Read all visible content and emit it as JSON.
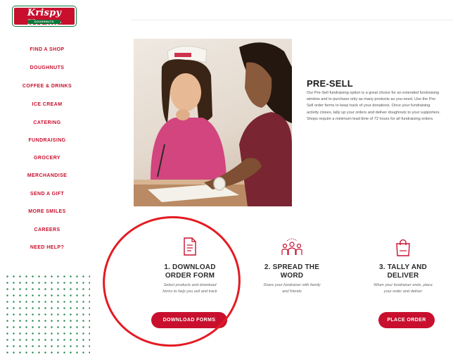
{
  "brand": {
    "logo_text": "Krispy Kreme",
    "logo_sub": "DOUGHNUTS",
    "primary_color": "#c8102e",
    "accent_green": "#0b7a3b"
  },
  "nav": {
    "items": [
      "FIND A SHOP",
      "DOUGHNUTS",
      "COFFEE & DRINKS",
      "ICE CREAM",
      "CATERING",
      "FUNDRAISING",
      "GROCERY",
      "MERCHANDISE",
      "SEND A GIFT",
      "MORE SMILES",
      "CAREERS",
      "NEED HELP?"
    ]
  },
  "presell": {
    "title": "PRE-SELL",
    "body": "Our Pre-Sell fundraising option is a great choice for an extended fundraising window and to purchase only as many products as you need. Use the Pre-Sell order forms to keep track of your donations.  Once your fundraising activity closes, tally up your orders and deliver doughnuts to your supporters. Shops require a minimum lead time of 72 hours for all fundraising orders."
  },
  "steps": [
    {
      "icon": "document-icon",
      "title_line1": "1. DOWNLOAD",
      "title_line2": "ORDER FORM",
      "desc_line1": "Select products and download",
      "desc_line2": "forms to help you sell and track",
      "button": "DOWNLOAD FORMS"
    },
    {
      "icon": "people-group-icon",
      "title_line1": "2. SPREAD THE",
      "title_line2": "WORD",
      "desc_line1": "Share your fundraiser with family",
      "desc_line2": "and friends",
      "button": ""
    },
    {
      "icon": "shopping-bag-icon",
      "title_line1": "3. TALLY AND",
      "title_line2": "DELIVER",
      "desc_line1": "When your fundraiser ends, place",
      "desc_line2": "your order and deliver",
      "button": "PLACE ORDER"
    }
  ],
  "annotation": {
    "circle_color": "#e31b23"
  }
}
